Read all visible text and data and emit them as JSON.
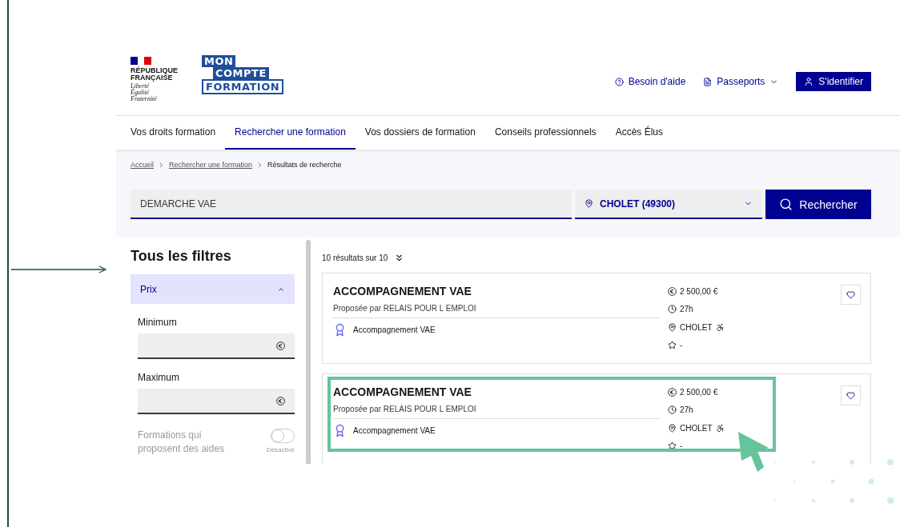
{
  "header": {
    "republic": {
      "name": [
        "RÉPUBLIQUE",
        "FRANÇAISE"
      ],
      "motto": [
        "Liberté",
        "Égalité",
        "Fraternité"
      ]
    },
    "logo": [
      "MON",
      "COMPTE",
      "FORMATION"
    ],
    "links": [
      {
        "kind": "help",
        "label": "Besoin d'aide"
      },
      {
        "kind": "menu",
        "label": "Passeports"
      }
    ],
    "login_button": "S'identifier"
  },
  "nav": [
    {
      "label": "Vos droits formation",
      "selected": false
    },
    {
      "label": "Rechercher une formation",
      "selected": true
    },
    {
      "label": "Vos dossiers de formation",
      "selected": false
    },
    {
      "label": "Conseils professionnels",
      "selected": false
    },
    {
      "label": "Accès Élus",
      "selected": false
    }
  ],
  "breadcrumb": [
    {
      "kind": "link",
      "label": "Accueil"
    },
    {
      "kind": "link",
      "label": "Rechercher une formation"
    },
    {
      "kind": "current",
      "label": "Résultats de recherche"
    }
  ],
  "search": {
    "query": "DEMARCHE VAE",
    "location": "CHOLET (49300)",
    "button": "Rechercher"
  },
  "filters": {
    "title": "Tous les filtres",
    "section": {
      "label": "Prix",
      "expanded": true,
      "fields": [
        "Minimum",
        "Maximum"
      ]
    },
    "toggle": {
      "label": "Formations qui proposent des aides",
      "on": false,
      "status": "Désactivé"
    }
  },
  "results": {
    "count": "10 résultats sur 10",
    "cards": [
      {
        "title": "ACCOMPAGNEMENT VAE",
        "provider": "Proposée par RELAIS POUR L EMPLOI",
        "certification": "Accompagnement VAE",
        "price": "2 500,00 €",
        "duration": "27h",
        "city": "CHOLET",
        "rating": "-",
        "highlighted": false
      },
      {
        "title": "ACCOMPAGNEMENT VAE",
        "provider": "Proposée par RELAIS POUR L EMPLOI",
        "certification": "Accompagnement VAE",
        "price": "2 500,00 €",
        "duration": "27h",
        "city": "CHOLET",
        "rating": "-",
        "highlighted": true
      }
    ]
  }
}
